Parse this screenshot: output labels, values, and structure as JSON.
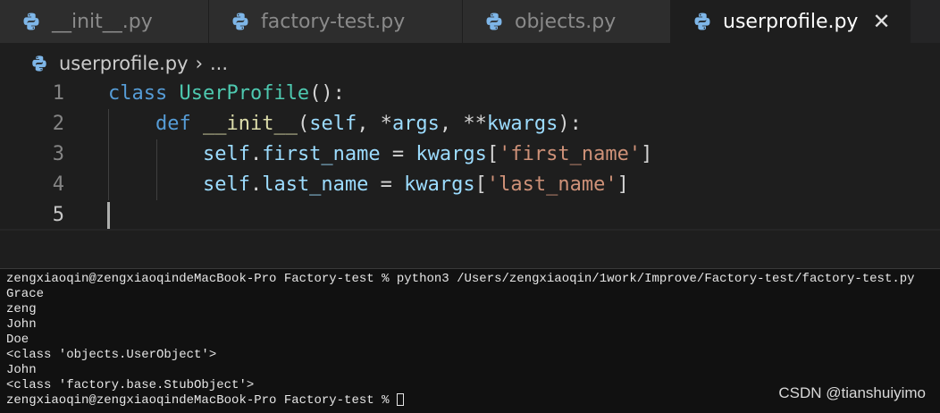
{
  "colors": {
    "python_icon": "#7eb6e8",
    "keyword": "#569cd6",
    "class_name": "#4ec9b0",
    "function": "#dcdcaa",
    "string": "#ce9178"
  },
  "tabs": [
    {
      "label": "__init__.py",
      "icon": "python-icon",
      "active": false
    },
    {
      "label": "factory-test.py",
      "icon": "python-icon",
      "active": false
    },
    {
      "label": "objects.py",
      "icon": "python-icon",
      "active": false
    },
    {
      "label": "userprofile.py",
      "icon": "python-icon",
      "active": true,
      "close": "✕"
    }
  ],
  "breadcrumb": {
    "file": "userprofile.py",
    "sep": "›",
    "more": "..."
  },
  "editor": {
    "line_numbers": [
      "1",
      "2",
      "3",
      "4",
      "5"
    ],
    "lines": [
      [
        {
          "t": "class",
          "c": "kw"
        },
        {
          "t": " ",
          "c": "plain"
        },
        {
          "t": "UserProfile",
          "c": "cls"
        },
        {
          "t": "():",
          "c": "plain"
        }
      ],
      [
        {
          "t": "    ",
          "c": "plain"
        },
        {
          "t": "def",
          "c": "kw"
        },
        {
          "t": " ",
          "c": "plain"
        },
        {
          "t": "__init__",
          "c": "fn"
        },
        {
          "t": "(",
          "c": "plain"
        },
        {
          "t": "self",
          "c": "self"
        },
        {
          "t": ", *",
          "c": "plain"
        },
        {
          "t": "args",
          "c": "param"
        },
        {
          "t": ", **",
          "c": "plain"
        },
        {
          "t": "kwargs",
          "c": "param"
        },
        {
          "t": "):",
          "c": "plain"
        }
      ],
      [
        {
          "t": "        ",
          "c": "plain"
        },
        {
          "t": "self",
          "c": "self"
        },
        {
          "t": ".",
          "c": "plain"
        },
        {
          "t": "first_name",
          "c": "self"
        },
        {
          "t": " = ",
          "c": "plain"
        },
        {
          "t": "kwargs",
          "c": "param"
        },
        {
          "t": "[",
          "c": "plain"
        },
        {
          "t": "'first_name'",
          "c": "str"
        },
        {
          "t": "]",
          "c": "plain"
        }
      ],
      [
        {
          "t": "        ",
          "c": "plain"
        },
        {
          "t": "self",
          "c": "self"
        },
        {
          "t": ".",
          "c": "plain"
        },
        {
          "t": "last_name",
          "c": "self"
        },
        {
          "t": " = ",
          "c": "plain"
        },
        {
          "t": "kwargs",
          "c": "param"
        },
        {
          "t": "[",
          "c": "plain"
        },
        {
          "t": "'last_name'",
          "c": "str"
        },
        {
          "t": "]",
          "c": "plain"
        }
      ],
      []
    ]
  },
  "terminal": {
    "prompt_line": "zengxiaoqin@zengxiaoqindeMacBook-Pro Factory-test % python3 /Users/zengxiaoqin/1work/Improve/Factory-test/factory-test.py",
    "output": [
      "Grace",
      "zeng",
      "John",
      "Doe",
      "<class 'objects.UserObject'>",
      "John",
      "<class 'factory.base.StubObject'>"
    ],
    "final_prompt": "zengxiaoqin@zengxiaoqindeMacBook-Pro Factory-test % "
  },
  "watermark": "CSDN @tianshuiyimo"
}
